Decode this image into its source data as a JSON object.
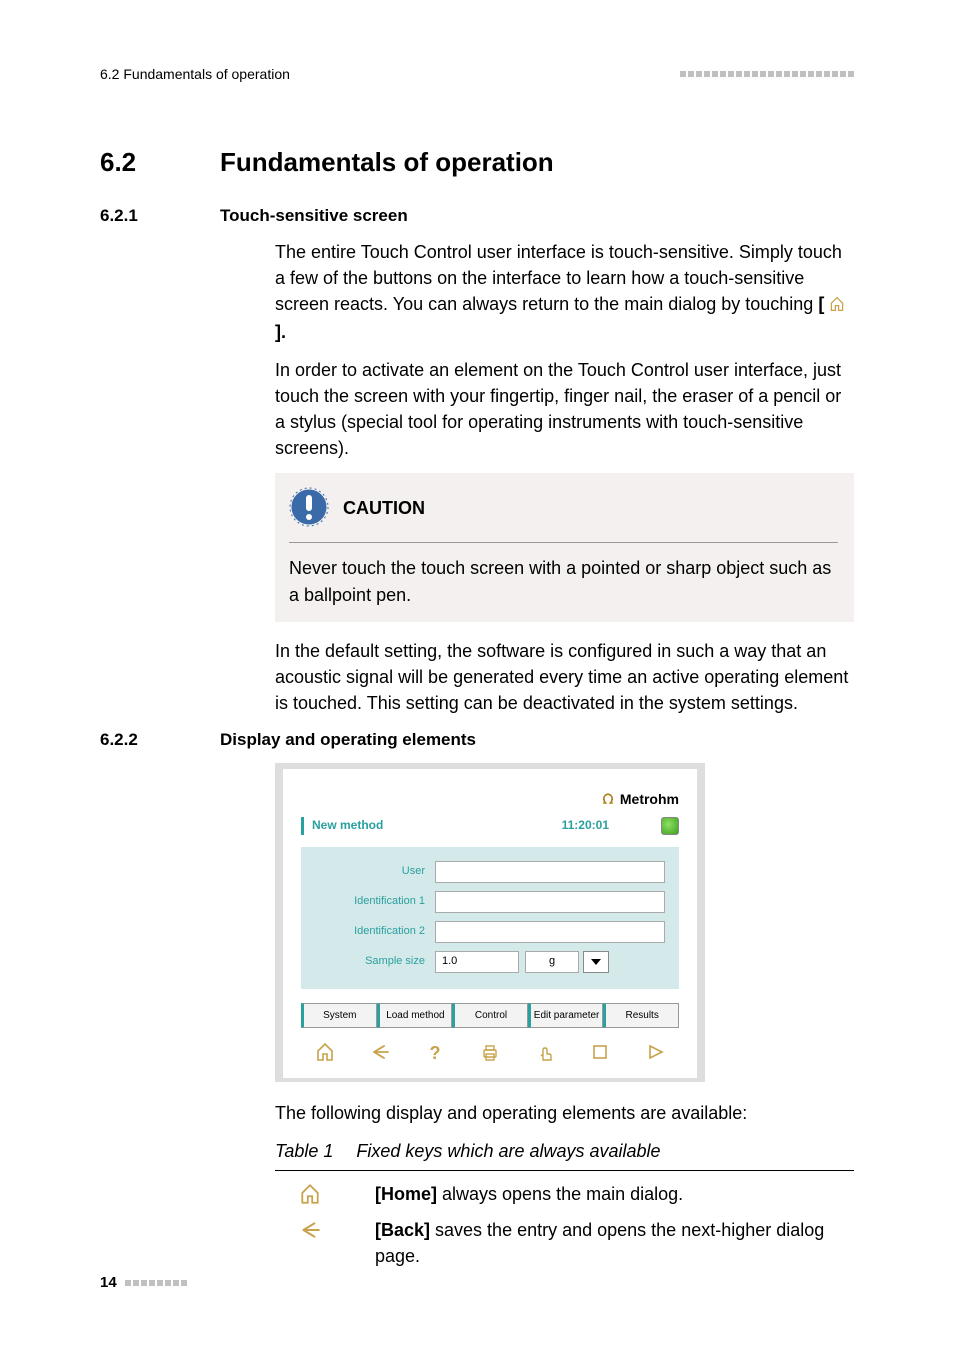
{
  "header": {
    "left": "6.2 Fundamentals of operation"
  },
  "section": {
    "number": "6.2",
    "title": "Fundamentals of operation"
  },
  "sub1": {
    "number": "6.2.1",
    "title": "Touch-sensitive screen",
    "para1_a": "The entire Touch Control user interface is touch-sensitive. Simply touch a few of the buttons on the interface to learn how a touch-sensitive screen reacts. You can always return to the main dialog by touching ",
    "para1_b": "[ ",
    "para1_c": " ].",
    "para2": "In order to activate an element on the Touch Control user interface, just touch the screen with your fingertip, finger nail, the eraser of a pencil or a stylus (special tool for operating instruments with touch-sensitive screens).",
    "caution_label": "CAUTION",
    "caution_text": "Never touch the touch screen with a pointed or sharp object such as a ballpoint pen.",
    "para3": "In the default setting, the software is configured in such a way that an acoustic signal will be generated every time an active operating element is touched. This setting can be deactivated in the system settings."
  },
  "sub2": {
    "number": "6.2.2",
    "title": "Display and operating elements",
    "screenshot": {
      "brand": "Metrohm",
      "title": "New method",
      "time": "11:20:01",
      "fields": {
        "user": "User",
        "id1": "Identification 1",
        "id2": "Identification 2",
        "sample": "Sample size",
        "sample_value": "1.0",
        "sample_unit": "g"
      },
      "tabs": [
        "System",
        "Load method",
        "Control",
        "Edit parameter",
        "Results"
      ]
    },
    "after_shot": "The following display and operating elements are available:",
    "table_caption_num": "Table 1",
    "table_caption_text": "Fixed keys which are always available",
    "rows": [
      {
        "key_name": "[Home]",
        "desc_rest": " always opens the main dialog."
      },
      {
        "key_name": "[Back]",
        "desc_rest": " saves the entry and opens the next-higher dialog page."
      }
    ]
  },
  "footer": {
    "page": "14"
  }
}
